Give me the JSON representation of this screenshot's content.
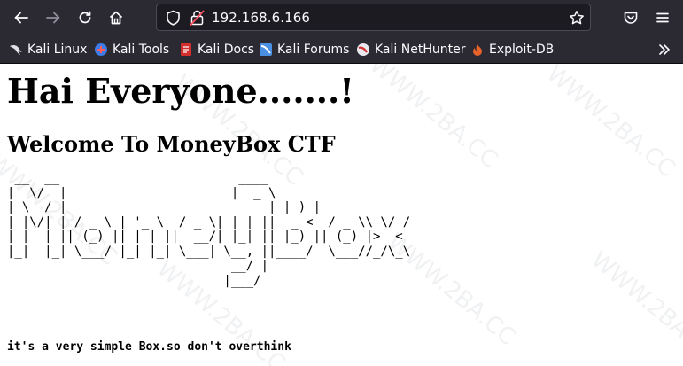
{
  "browser": {
    "url": "192.168.6.166",
    "bookmarks": [
      {
        "label": "Kali Linux",
        "icon": "kali-dragon-icon"
      },
      {
        "label": "Kali Tools",
        "icon": "kali-tools-icon"
      },
      {
        "label": "Kali Docs",
        "icon": "kali-docs-icon"
      },
      {
        "label": "Kali Forums",
        "icon": "kali-forums-icon"
      },
      {
        "label": "Kali NetHunter",
        "icon": "kali-nethunter-icon"
      },
      {
        "label": "Exploit-DB",
        "icon": "exploit-db-icon"
      }
    ],
    "colors": {
      "toolbar_bg": "#2b2a33",
      "urlbar_bg": "#1c1b22",
      "text": "#fbfbfe"
    }
  },
  "page": {
    "heading": "Hai Everyone.......!",
    "subheading": "Welcome To MoneyBox CTF",
    "ascii_art": " __  __                        ____            \n|  \\/  |                      |  _ \\           \n| \\  / |  ___   _ __    ___  _   _ | |_) |  ___ __  __\n| |\\/| | / _ \\ | '_ \\  / _ \\| | | ||  _ <  / _ \\\\ \\/ /\n| |  | || (_) || | | ||  __/| |_| || |_) || (_) |>  < \n|_|  |_| \\___/ |_| |_| \\___| \\__, ||____/  \\___//_/\\_\\\n                              __/ |                  \n                             |___/                   ",
    "note": "it's a very simple Box.so don't overthink",
    "watermark": "WWW.2BA.CC"
  }
}
